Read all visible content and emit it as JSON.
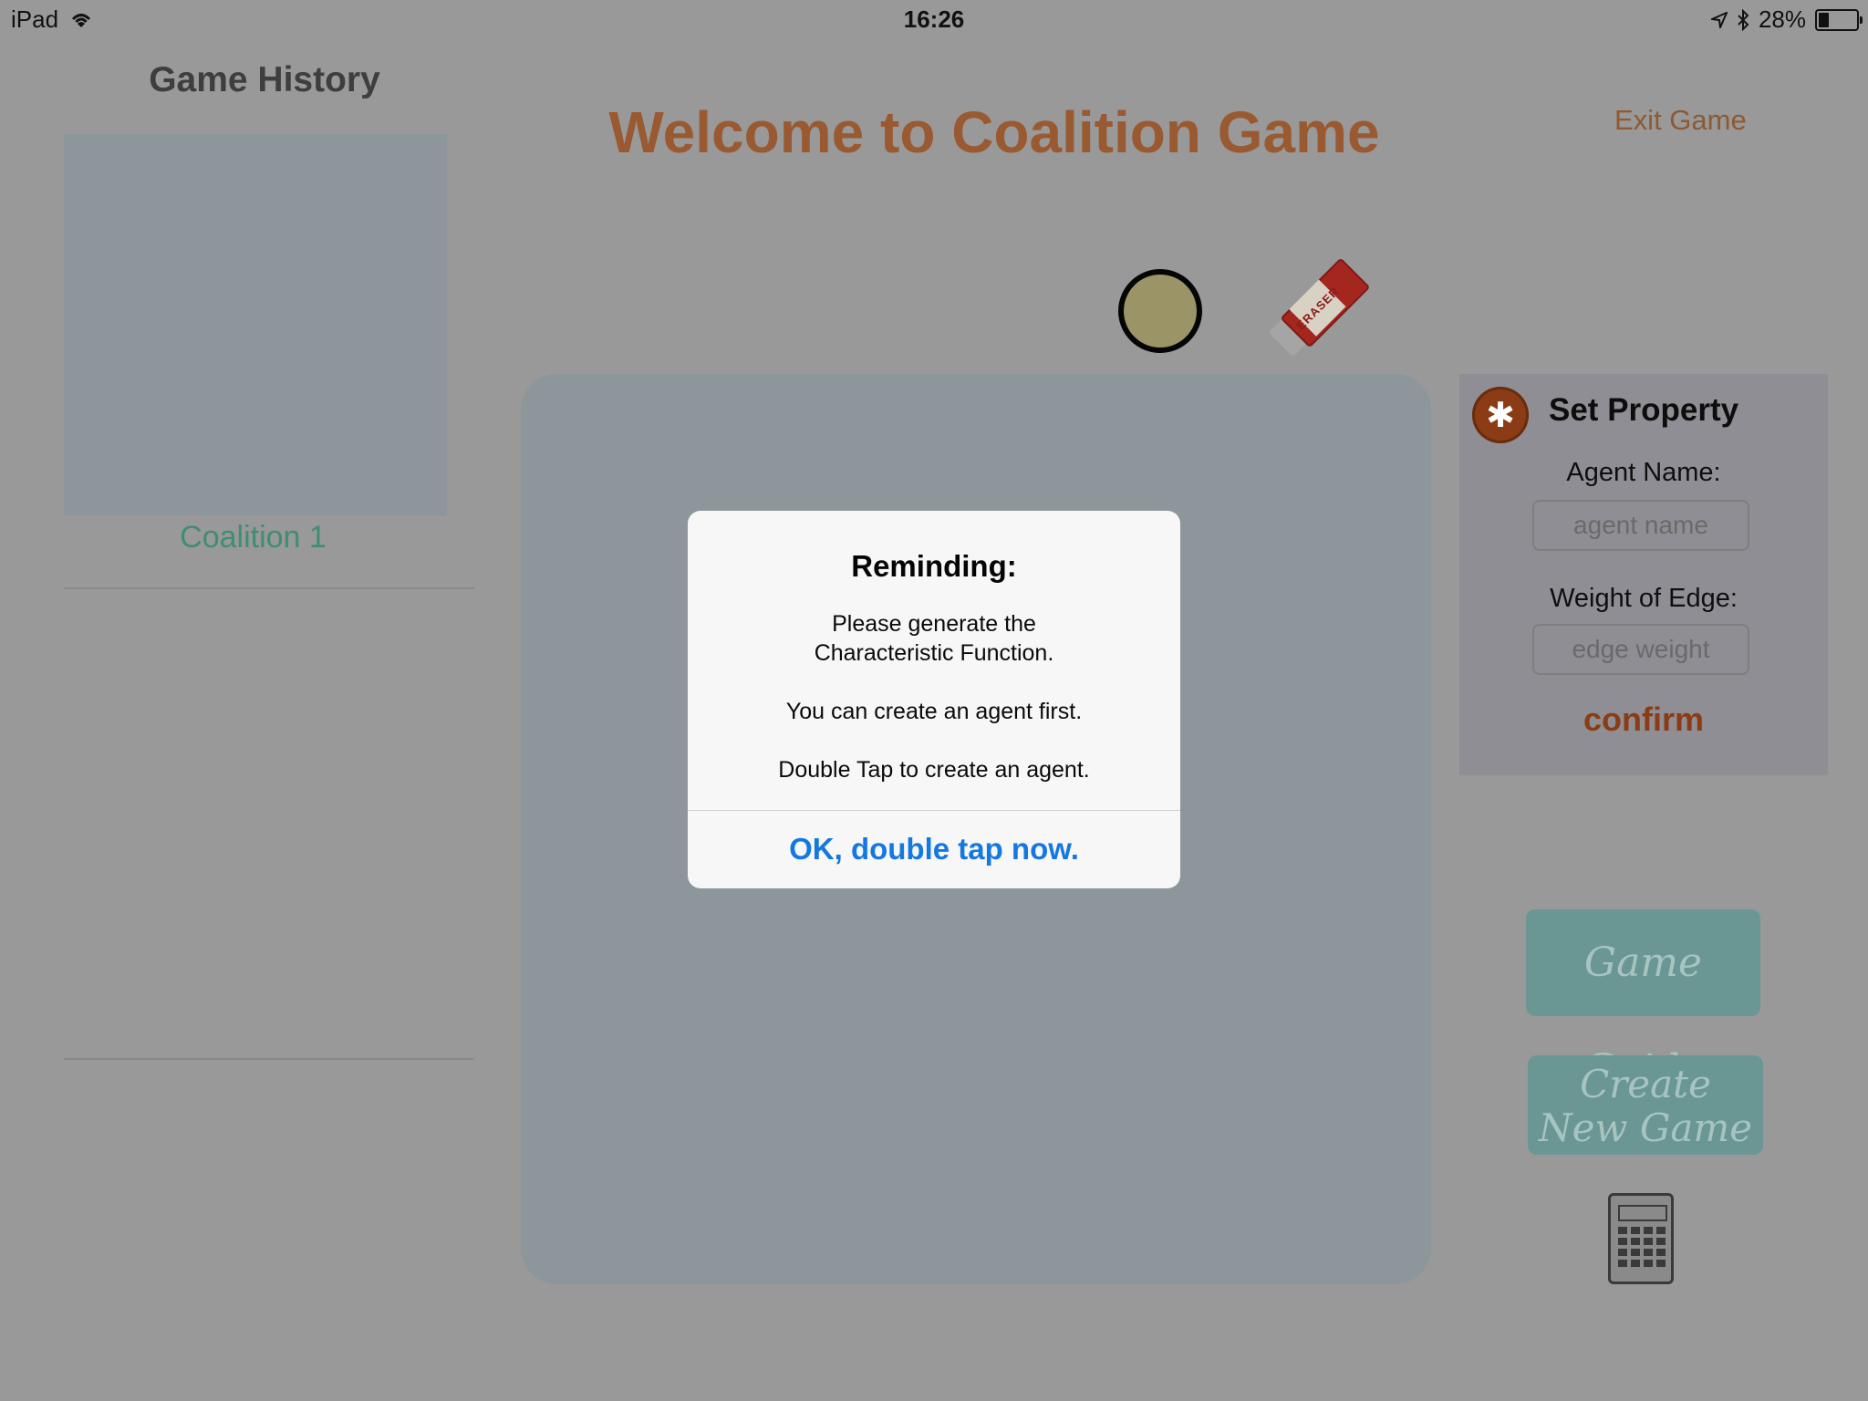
{
  "status_bar": {
    "device": "iPad",
    "time": "16:26",
    "battery_percent": "28%",
    "battery_level": 0.28
  },
  "sidebar": {
    "title": "Game History",
    "coalition_label": "Coalition 1"
  },
  "header": {
    "title": "Welcome to Coalition Game",
    "exit_label": "Exit Game"
  },
  "tools": {
    "node_icon": "circle-node-icon",
    "eraser_icon": "eraser-icon",
    "eraser_text": "ERASER"
  },
  "property_panel": {
    "title": "Set Property",
    "agent_name_label": "Agent Name:",
    "agent_name_placeholder": "agent name",
    "agent_name_value": "",
    "weight_label": "Weight of Edge:",
    "weight_placeholder": "edge weight",
    "weight_value": "",
    "confirm_label": "confirm"
  },
  "buttons": {
    "game_guide": "Game Guide",
    "create_line1": "Create",
    "create_line2": "New Game",
    "calculator_icon": "calculator-icon"
  },
  "modal": {
    "title": "Reminding:",
    "line1": "Please generate the",
    "line2": "Characteristic Function.",
    "line3": "You can create an agent first.",
    "line4": "Double Tap to create an agent.",
    "ok_label": "OK, double tap now."
  },
  "colors": {
    "accent_brown": "#9a5a31",
    "accent_teal": "#3f8d74",
    "ios_blue": "#1478e3",
    "dim_overlay": "#999999"
  }
}
